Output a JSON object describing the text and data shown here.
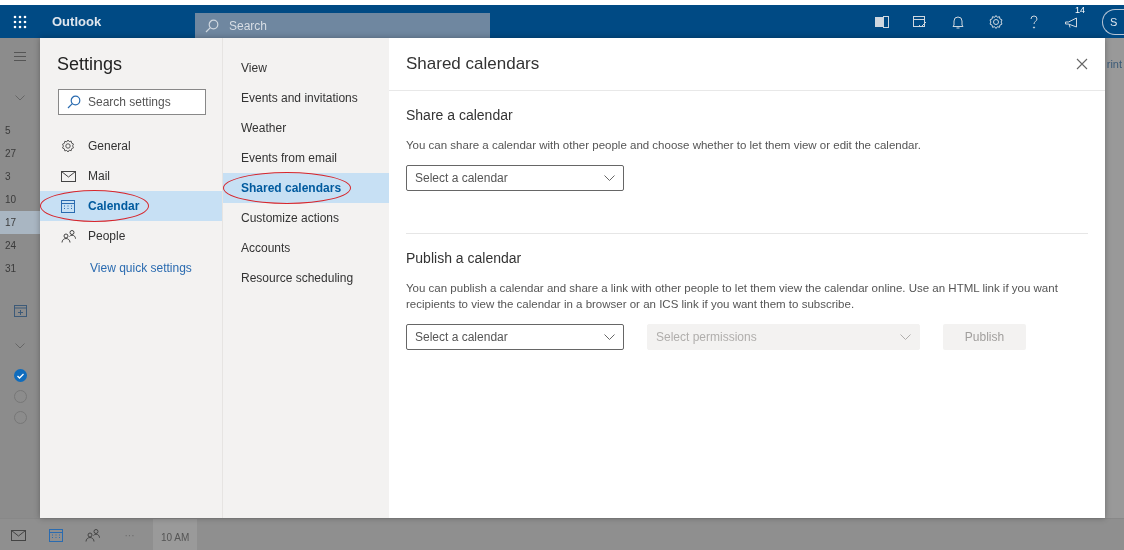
{
  "topbar": {
    "app_name": "Outlook",
    "search": {
      "placeholder": "Search"
    },
    "notification_count": "14",
    "avatar_initial": "S"
  },
  "background": {
    "dates": [
      {
        "label": "5",
        "selected": false
      },
      {
        "label": "27",
        "selected": false
      },
      {
        "label": "3",
        "selected": false
      },
      {
        "label": "10",
        "selected": false
      },
      {
        "label": "17",
        "selected": true
      },
      {
        "label": "24",
        "selected": false
      },
      {
        "label": "31",
        "selected": false
      }
    ],
    "calendars": [
      {
        "checked": true
      },
      {
        "checked": false
      },
      {
        "checked": false
      }
    ],
    "more": "···",
    "time_label": "10 AM",
    "edge_text": "rint"
  },
  "settings": {
    "title": "Settings",
    "search": {
      "placeholder": "Search settings"
    },
    "categories": [
      {
        "label": "General",
        "kind": "gear",
        "selected": false,
        "circled": false
      },
      {
        "label": "Mail",
        "kind": "mail",
        "selected": false,
        "circled": false
      },
      {
        "label": "Calendar",
        "kind": "calendar",
        "selected": true,
        "circled": true
      },
      {
        "label": "People",
        "kind": "people",
        "selected": false,
        "circled": false
      }
    ],
    "quick_link": "View quick settings",
    "subcategories": [
      {
        "label": "View",
        "selected": false,
        "circled": false
      },
      {
        "label": "Events and invitations",
        "selected": false,
        "circled": false
      },
      {
        "label": "Weather",
        "selected": false,
        "circled": false
      },
      {
        "label": "Events from email",
        "selected": false,
        "circled": false
      },
      {
        "label": "Shared calendars",
        "selected": true,
        "circled": true
      },
      {
        "label": "Customize actions",
        "selected": false,
        "circled": false
      },
      {
        "label": "Accounts",
        "selected": false,
        "circled": false
      },
      {
        "label": "Resource scheduling",
        "selected": false,
        "circled": false
      }
    ]
  },
  "panel": {
    "title": "Shared calendars",
    "sections": [
      {
        "heading": "Share a calendar",
        "description": "You can share a calendar with other people and choose whether to let them view or edit the calendar.",
        "controls": [
          {
            "kind": "dropdown",
            "placeholder": "Select a calendar",
            "disabled": false
          }
        ]
      },
      {
        "heading": "Publish a calendar",
        "description": "You can publish a calendar and share a link with other people to let them view the calendar online. Use an HTML link if you want recipients to view the calendar in a browser or an ICS link if you want them to subscribe.",
        "controls": [
          {
            "kind": "dropdown",
            "placeholder": "Select a calendar",
            "disabled": false
          },
          {
            "kind": "dropdown",
            "placeholder": "Select permissions",
            "disabled": true
          },
          {
            "kind": "button",
            "label": "Publish",
            "disabled": true
          }
        ]
      }
    ]
  }
}
